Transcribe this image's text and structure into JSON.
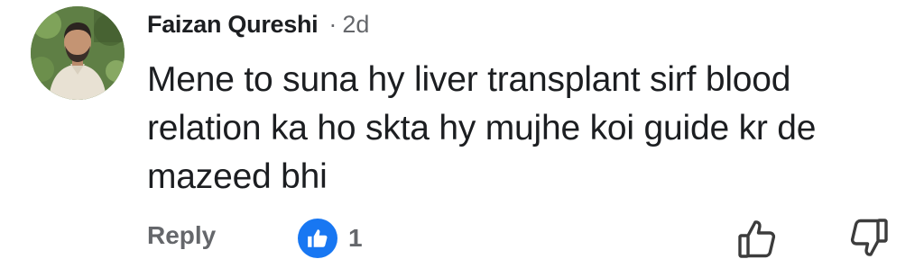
{
  "comment": {
    "author": "Faizan Qureshi",
    "separator": "·",
    "time": "2d",
    "text": "Mene to suna hy liver transplant sirf blood relation ka ho skta hy mujhe koi guide kr de mazeed bhi",
    "avatar": "user-avatar"
  },
  "actions": {
    "reply_label": "Reply",
    "reaction_icon": "like-icon",
    "reaction_count": "1",
    "upvote_icon": "thumbs-up-icon",
    "downvote_icon": "thumbs-down-icon"
  },
  "colors": {
    "text_primary": "#1c1e21",
    "text_secondary": "#65676b",
    "like_blue": "#1877f2"
  }
}
